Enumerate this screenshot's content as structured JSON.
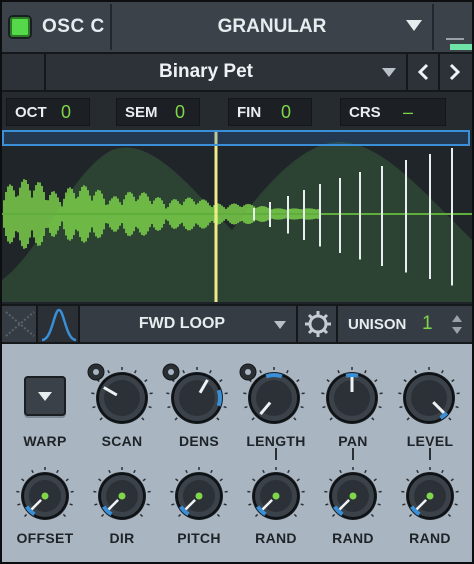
{
  "header": {
    "osc_title": "OSC C",
    "mode": "GRANULAR"
  },
  "preset": {
    "name": "Binary Pet"
  },
  "tuning": [
    {
      "label": "OCT",
      "value": "0"
    },
    {
      "label": "SEM",
      "value": "0"
    },
    {
      "label": "FIN",
      "value": "0"
    },
    {
      "label": "CRS",
      "value": "–"
    }
  ],
  "strip": {
    "loop_mode": "FWD LOOP",
    "unison_label": "UNISON",
    "unison_value": "1"
  },
  "controls": {
    "warp_label": "WARP",
    "top_knobs": [
      "SCAN",
      "DENS",
      "LENGTH",
      "PAN",
      "LEVEL"
    ],
    "bottom_knobs": [
      "OFFSET",
      "DIR",
      "PITCH",
      "RAND",
      "RAND",
      "RAND"
    ]
  },
  "colors": {
    "accent_green": "#7fd64b",
    "accent_blue": "#3a8fd6",
    "playhead": "#f2e98a"
  }
}
